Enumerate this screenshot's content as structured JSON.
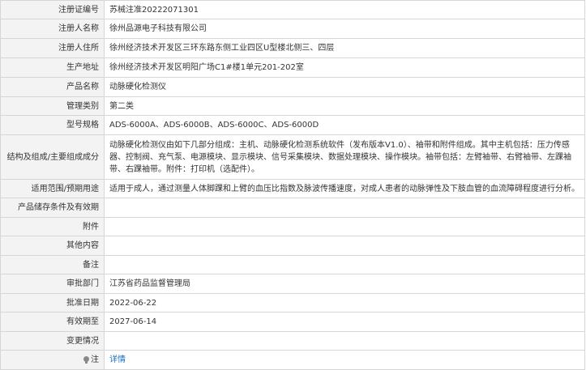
{
  "rows": [
    {
      "label": "注册证编号",
      "value": "苏械注准20222071301"
    },
    {
      "label": "注册人名称",
      "value": "徐州品源电子科技有限公司"
    },
    {
      "label": "注册人住所",
      "value": "徐州经济技术开发区三环东路东侧工业四区U型楼北侧三、四层"
    },
    {
      "label": "生产地址",
      "value": "徐州经济技术开发区明阳广场C1#楼1单元201-202室"
    },
    {
      "label": "产品名称",
      "value": "动脉硬化检测仪"
    },
    {
      "label": "管理类别",
      "value": "第二类"
    },
    {
      "label": "型号规格",
      "value": "ADS-6000A、ADS-6000B、ADS-6000C、ADS-6000D"
    },
    {
      "label": "结构及组成/主要组成成分",
      "value": "动脉硬化检测仪由如下几部分组成：主机、动脉硬化检测系统软件（发布版本V1.0）、袖带和附件组成。其中主机包括：压力传感器、控制阀、充气泵、电源模块、显示模块、信号采集模块、数据处理模块、操作模块。袖带包括：左臂袖带、右臂袖带、左踝袖带、右踝袖带。附件：打印机（选配件）。"
    },
    {
      "label": "适用范围/预期用途",
      "value": "适用于成人，通过测量人体脚踝和上臂的血压比指数及脉波传播速度，对成人患者的动脉弹性及下肢血管的血流障碍程度进行分析。"
    },
    {
      "label": "产品储存条件及有效期",
      "value": ""
    },
    {
      "label": "附件",
      "value": ""
    },
    {
      "label": "其他内容",
      "value": ""
    },
    {
      "label": "备注",
      "value": ""
    },
    {
      "label": "审批部门",
      "value": "江苏省药品监督管理局"
    },
    {
      "label": "批准日期",
      "value": "2022-06-22"
    },
    {
      "label": "有效期至",
      "value": "2027-06-14"
    },
    {
      "label": "变更情况",
      "value": ""
    }
  ],
  "note": {
    "label": "注",
    "icon": "lightbulb-icon",
    "link_text": "详情",
    "link_color": "#1a6fc4"
  }
}
